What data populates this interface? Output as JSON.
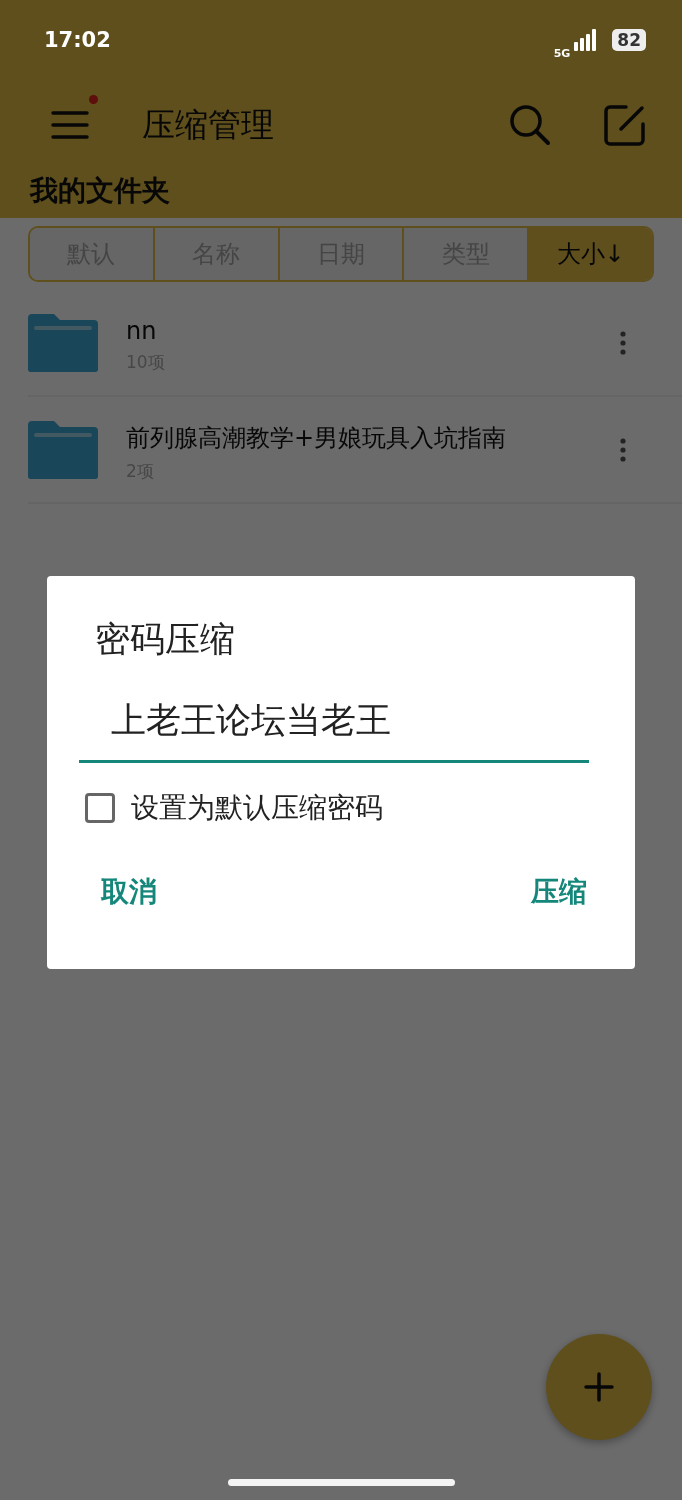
{
  "status_bar": {
    "time": "17:02",
    "network": "5G",
    "battery": "82"
  },
  "app_bar": {
    "title": "压缩管理",
    "menu_badge": true
  },
  "section_title": "我的文件夹",
  "sort_tabs": [
    {
      "label": "默认",
      "selected": false
    },
    {
      "label": "名称",
      "selected": false
    },
    {
      "label": "日期",
      "selected": false
    },
    {
      "label": "类型",
      "selected": false
    },
    {
      "label": "大小↓",
      "selected": true
    }
  ],
  "folders": [
    {
      "name": "nn",
      "count": "10项"
    },
    {
      "name": "前列腺高潮教学+男娘玩具入坑指南",
      "count": "2项"
    }
  ],
  "dialog": {
    "title": "密码压缩",
    "password": "上老王论坛当老王",
    "checkbox": {
      "label": "设置为默认压缩密码",
      "checked": false
    },
    "cancel": "取消",
    "confirm": "压缩"
  }
}
